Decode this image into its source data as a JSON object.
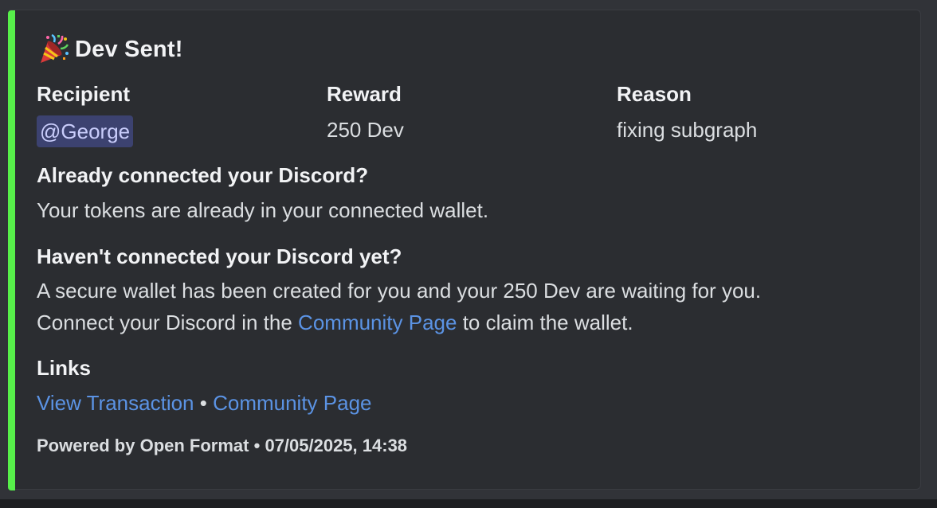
{
  "colors": {
    "embed_accent": "#57f04a",
    "embed_background": "#2b2d31",
    "link": "#5b93e4",
    "mention_background": "#3c4270",
    "mention_text": "#c9cdfb"
  },
  "embed": {
    "title": "Dev Sent!",
    "title_icon": "party-popper-icon",
    "fields": {
      "recipient": {
        "name": "Recipient",
        "value": "@George"
      },
      "reward": {
        "name": "Reward",
        "value": "250 Dev"
      },
      "reason": {
        "name": "Reason",
        "value": "fixing subgraph"
      }
    },
    "already_connected": {
      "heading": "Already connected your Discord?",
      "text": "Your tokens are already in your connected wallet."
    },
    "not_connected": {
      "heading": "Haven't connected your Discord yet?",
      "line1": "A secure wallet has been created for you and your 250 Dev are waiting for you.",
      "line2_prefix": "Connect your Discord in the ",
      "line2_link": "Community Page",
      "line2_suffix": " to claim the wallet."
    },
    "links": {
      "heading": "Links",
      "view_transaction": "View Transaction",
      "separator": " • ",
      "community_page": "Community Page"
    },
    "footer": {
      "text": "Powered by Open Format",
      "separator": " • ",
      "timestamp": "07/05/2025, 14:38"
    }
  }
}
